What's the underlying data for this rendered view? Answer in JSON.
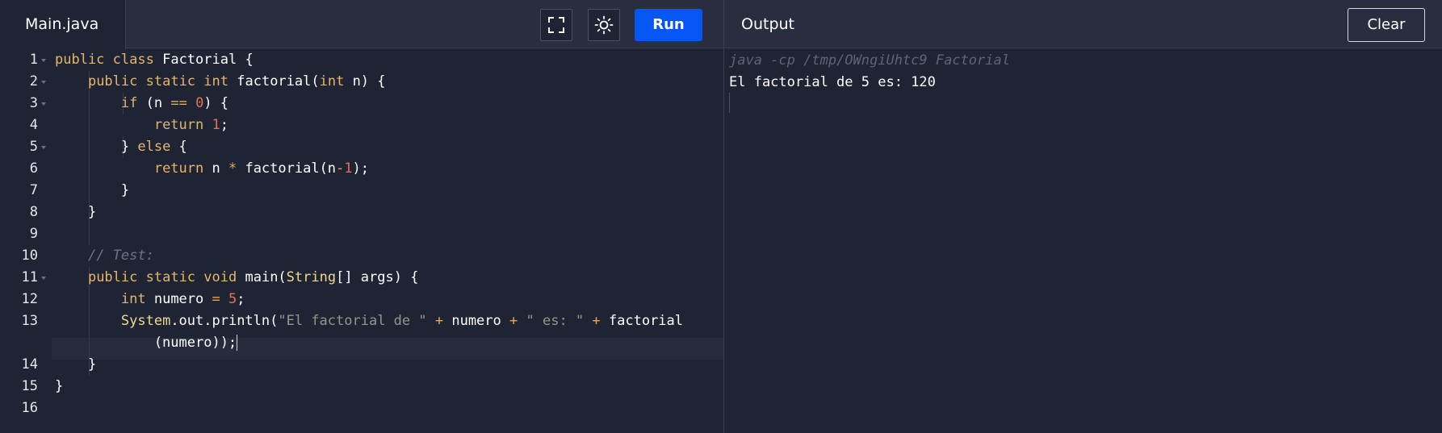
{
  "tab": {
    "filename": "Main.java"
  },
  "toolbar": {
    "fullscreen_icon": "fullscreen-icon",
    "theme_icon": "sun-icon",
    "run_label": "Run"
  },
  "output": {
    "title": "Output",
    "clear_label": "Clear",
    "command": "java -cp /tmp/OWngiUhtc9 Factorial",
    "result": "El factorial de 5 es: 120"
  },
  "editor": {
    "line_numbers": [
      "1",
      "2",
      "3",
      "4",
      "5",
      "6",
      "7",
      "8",
      "9",
      "10",
      "11",
      "12",
      "13",
      "14",
      "15",
      "16"
    ],
    "lines": [
      "public class Factorial {",
      "    public static int factorial(int n) {",
      "        if (n == 0) {",
      "            return 1;",
      "        } else {",
      "            return n * factorial(n-1);",
      "        }",
      "    }",
      "",
      "    // Test:",
      "    public static void main(String[] args) {",
      "        int numero = 5;",
      "        System.out.println(\"El factorial de \" + numero + \" es: \" + factorial",
      "            (numero));",
      "    }",
      "}",
      ""
    ]
  },
  "colors": {
    "background": "#1e2434",
    "topbar": "#282e3f",
    "run_button": "#0556f3",
    "keyword": "#e5b56a",
    "number": "#e8704f",
    "string": "#8d9a86",
    "comment": "#6d7384"
  }
}
